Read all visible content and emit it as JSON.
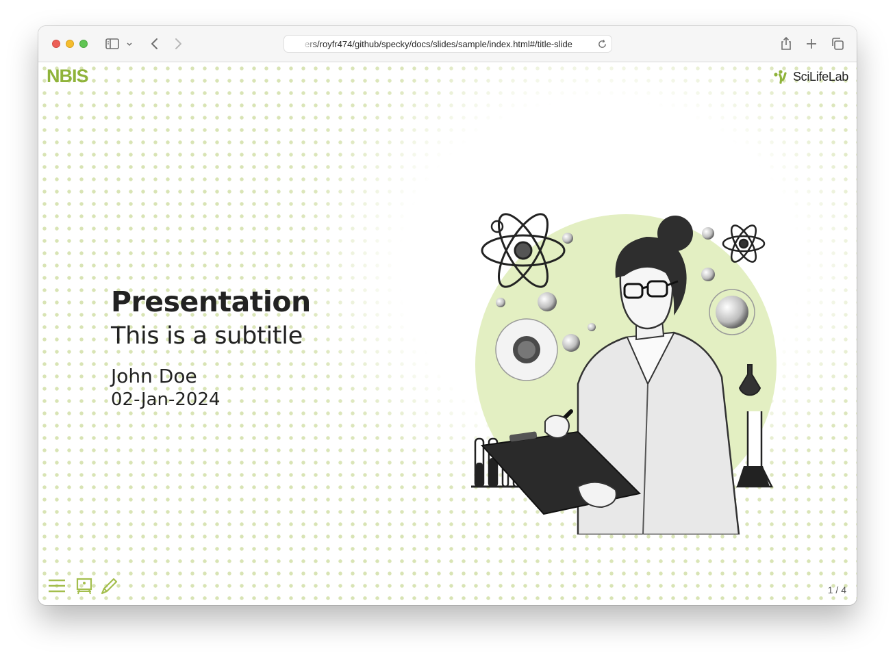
{
  "browser": {
    "url": "ers/royfr474/github/specky/docs/slides/sample/index.html#/title-slide"
  },
  "slide": {
    "logo_left": "NBIS",
    "logo_right": "SciLifeLab",
    "title": "Presentation",
    "subtitle": "This is a subtitle",
    "author": "John Doe",
    "date": "02-Jan-2024",
    "slide_number": "1 / 4",
    "illustration": "scientist-with-clipboard-and-lab-equipment",
    "accent_color": "#a3be4c",
    "highlight_circle_color": "#e3efc2"
  },
  "icons": {
    "sidebar": "sidebar-icon",
    "back": "chevron-left-icon",
    "forward": "chevron-right-icon",
    "reload": "reload-icon",
    "share": "share-icon",
    "new_tab": "plus-icon",
    "tabs": "tabs-overview-icon",
    "menu": "hamburger-menu-icon",
    "chalkboard": "chalkboard-icon",
    "pen": "pen-icon"
  }
}
